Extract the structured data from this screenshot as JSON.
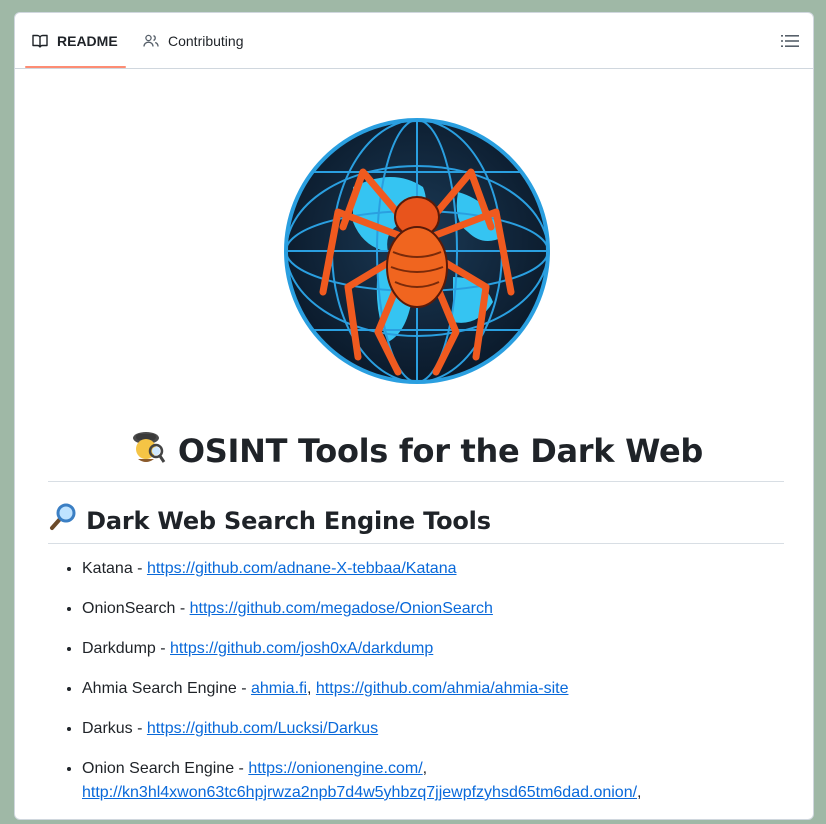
{
  "tabs": [
    {
      "label": "README",
      "icon": "book-icon",
      "active": true
    },
    {
      "label": "Contributing",
      "icon": "people-icon",
      "active": false
    }
  ],
  "accent": "#fd8c73",
  "link_color": "#0969da",
  "logo": {
    "description": "spider-globe-logo"
  },
  "heading": {
    "emoji": "detective-emoji",
    "text": "OSINT Tools for the Dark Web"
  },
  "section": {
    "emoji": "magnifier-emoji",
    "text": "Dark Web Search Engine Tools"
  },
  "items": [
    {
      "name": "Katana",
      "sep": " - ",
      "links": [
        "https://github.com/adnane-X-tebbaa/Katana"
      ]
    },
    {
      "name": "OnionSearch",
      "sep": " - ",
      "links": [
        "https://github.com/megadose/OnionSearch"
      ]
    },
    {
      "name": "Darkdump",
      "sep": " - ",
      "links": [
        "https://github.com/josh0xA/darkdump"
      ]
    },
    {
      "name": "Ahmia Search Engine",
      "sep": " - ",
      "links": [
        "ahmia.fi",
        "https://github.com/ahmia/ahmia-site"
      ]
    },
    {
      "name": "Darkus",
      "sep": " - ",
      "links": [
        "https://github.com/Lucksi/Darkus"
      ]
    },
    {
      "name": "Onion Search Engine",
      "sep": " - ",
      "links": [
        "https://onionengine.com/",
        "http://kn3hl4xwon63tc6hpjrwza2npb7d4w5yhbzq7jjewpfzyhsd65tm6dad.onion/"
      ],
      "trailing": ","
    }
  ]
}
